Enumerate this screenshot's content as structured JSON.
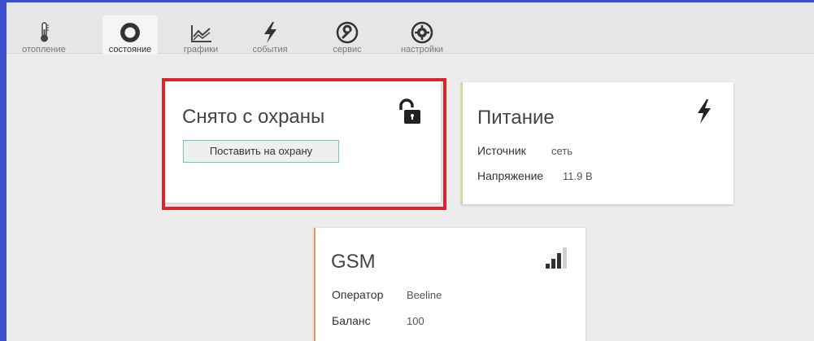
{
  "tabs": [
    {
      "label": "отопление",
      "icon": "thermometer-icon"
    },
    {
      "label": "состояние",
      "icon": "circle-status-icon",
      "active": true
    },
    {
      "label": "графики",
      "icon": "chart-icon"
    },
    {
      "label": "события",
      "icon": "lightning-icon"
    },
    {
      "label": "сервис",
      "icon": "wrench-icon"
    },
    {
      "label": "настройки",
      "icon": "gear-icon"
    }
  ],
  "security_card": {
    "title": "Снято с охраны",
    "button_label": "Поставить на охрану",
    "icon": "unlock-icon"
  },
  "power_card": {
    "title": "Питание",
    "icon": "lightning-icon",
    "source_label": "Источник",
    "source_value": "сеть",
    "voltage_label": "Напряжение",
    "voltage_value": "11.9 В",
    "accent_color": "#c9dc8a"
  },
  "gsm_card": {
    "title": "GSM",
    "icon": "signal-bars-icon",
    "operator_label": "Оператор",
    "operator_value": "Beeline",
    "balance_label": "Баланс",
    "balance_value": "100",
    "accent_color": "#e8946a"
  },
  "colors": {
    "frame": "#3d4fd1",
    "highlight": "#e0222c",
    "button_border": "#6fc6c9"
  }
}
